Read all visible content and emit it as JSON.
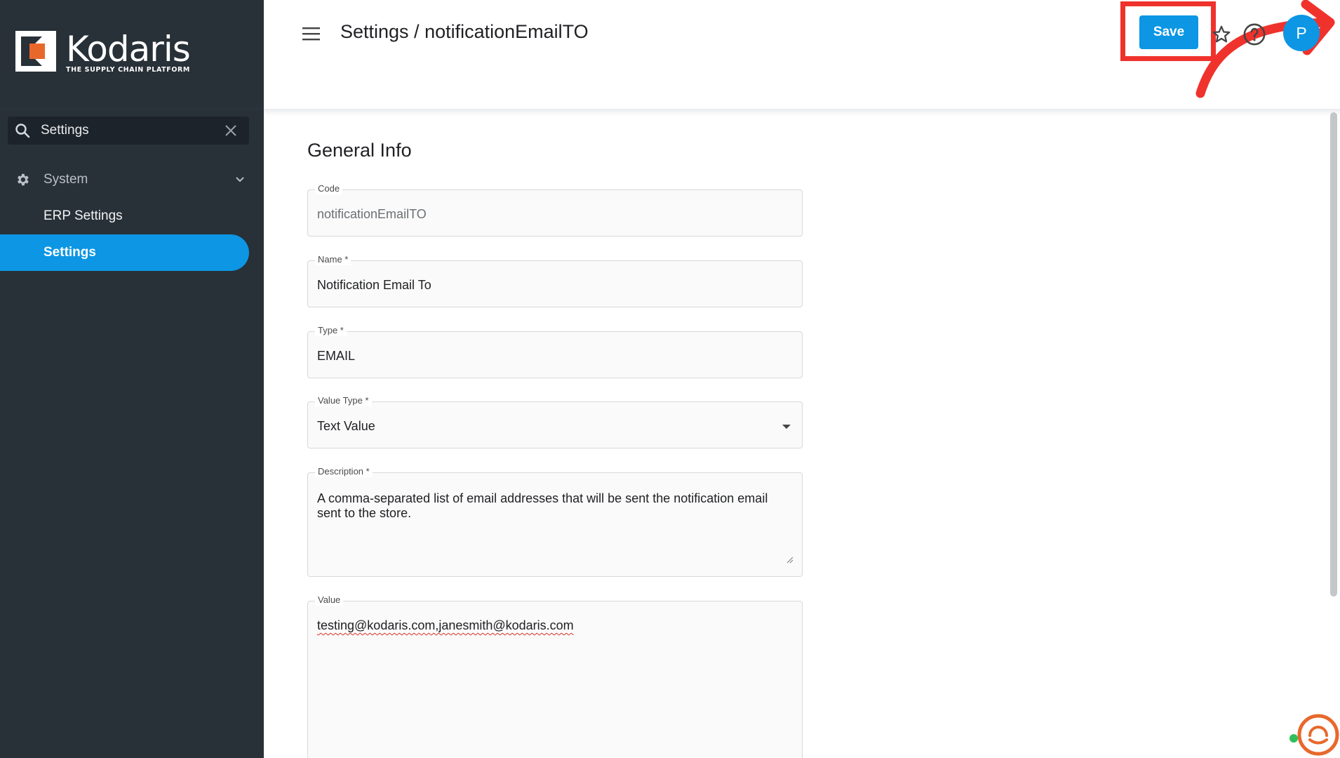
{
  "brand": {
    "name": "Kodaris",
    "tagline": "THE SUPPLY CHAIN PLATFORM",
    "accent_color": "#0c96e3",
    "logo_orange": "#e8682b"
  },
  "sidebar": {
    "search": {
      "value": "Settings",
      "placeholder": "Search"
    },
    "group": {
      "label": "System",
      "icon": "gear-icon"
    },
    "items": [
      {
        "label": "ERP Settings",
        "active": false
      },
      {
        "label": "Settings",
        "active": true
      }
    ]
  },
  "header": {
    "title": "Settings / notificationEmailTO",
    "save_label": "Save",
    "avatar_initial": "P"
  },
  "form": {
    "section_title": "General Info",
    "fields": {
      "code": {
        "label": "Code",
        "value": "notificationEmailTO"
      },
      "name": {
        "label": "Name *",
        "value": "Notification Email To"
      },
      "type": {
        "label": "Type *",
        "value": "EMAIL"
      },
      "value_type": {
        "label": "Value Type *",
        "value": "Text Value"
      },
      "description": {
        "label": "Description *",
        "value": "A comma-separated list of email addresses that will be sent the notification email sent to the store."
      },
      "value": {
        "label": "Value",
        "value": "testing@kodaris.com,janesmith@kodaris.com"
      }
    }
  },
  "annotation": {
    "highlight_color": "#f0322d",
    "target": "save-button"
  }
}
